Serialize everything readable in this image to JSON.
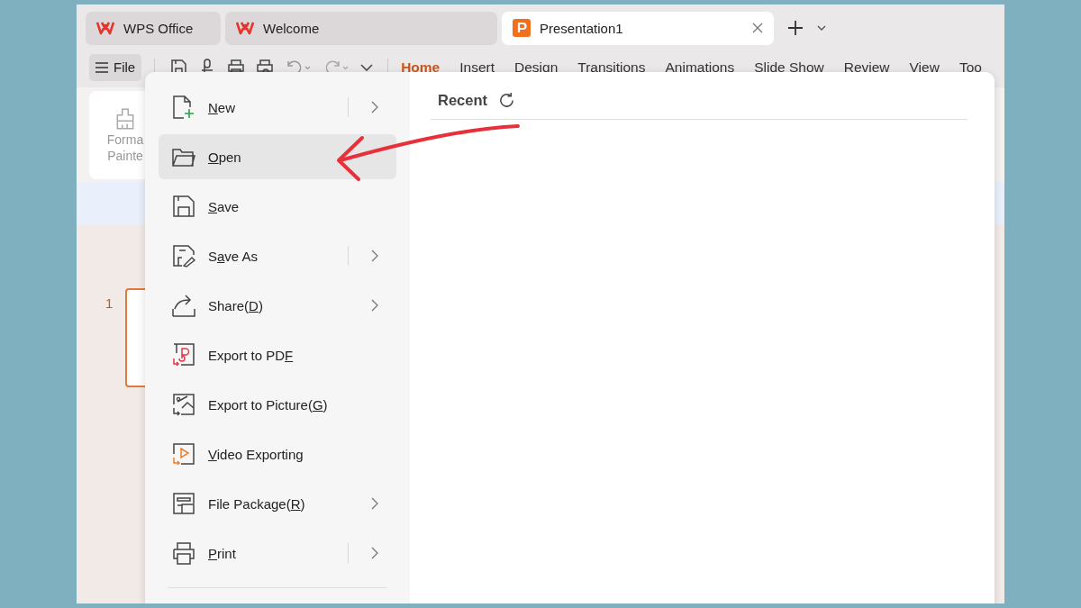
{
  "tabs": [
    {
      "label": "WPS Office",
      "selected": false,
      "closable": false
    },
    {
      "label": "Welcome",
      "selected": false,
      "closable": false
    },
    {
      "label": "Presentation1",
      "selected": true,
      "closable": true
    }
  ],
  "file_button": {
    "label": "File"
  },
  "ribbon_tabs": [
    {
      "label": "Home",
      "selected": true
    },
    {
      "label": "Insert",
      "selected": false
    },
    {
      "label": "Design",
      "selected": false
    },
    {
      "label": "Transitions",
      "selected": false
    },
    {
      "label": "Animations",
      "selected": false
    },
    {
      "label": "Slide Show",
      "selected": false
    },
    {
      "label": "Review",
      "selected": false
    },
    {
      "label": "View",
      "selected": false
    },
    {
      "label": "Too",
      "selected": false
    }
  ],
  "ribbon": {
    "format_painter": [
      "Forma",
      "Painte"
    ]
  },
  "slide_panel": {
    "slide_number": "1"
  },
  "file_menu": {
    "items": [
      {
        "key": "N",
        "after": "ew",
        "selected": false,
        "submenu": true,
        "split": true
      },
      {
        "key": "O",
        "after": "pen",
        "selected": true,
        "submenu": false,
        "split": false
      },
      {
        "key": "S",
        "after": "ave",
        "selected": false,
        "submenu": false,
        "split": false
      },
      {
        "before": "S",
        "key": "a",
        "after": "ve As",
        "selected": false,
        "submenu": true,
        "split": true
      },
      {
        "before": "Share(",
        "key": "D",
        "after": ")",
        "selected": false,
        "submenu": true,
        "split": false
      },
      {
        "before": "Export to PD",
        "key": "F",
        "selected": false,
        "submenu": false,
        "split": false
      },
      {
        "before": "Export to Picture(",
        "key": "G",
        "after": ")",
        "selected": false,
        "submenu": false,
        "split": false
      },
      {
        "key": "V",
        "after": "ideo Exporting",
        "selected": false,
        "submenu": false,
        "split": false
      },
      {
        "before": "File Package(",
        "key": "R",
        "after": ")",
        "selected": false,
        "submenu": true,
        "split": false
      },
      {
        "key": "P",
        "after": "rint",
        "selected": false,
        "submenu": true,
        "split": true
      }
    ],
    "recent_title": "Recent"
  }
}
